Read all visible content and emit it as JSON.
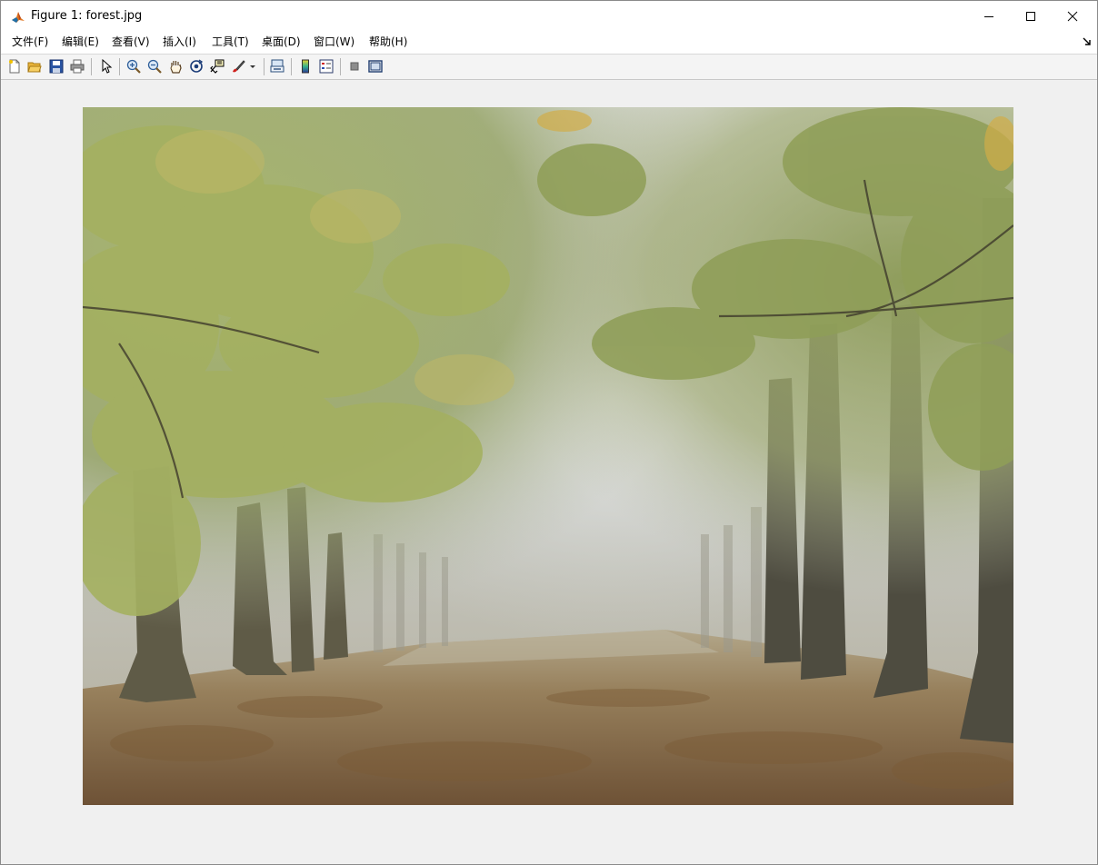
{
  "window": {
    "title": "Figure 1: forest.jpg",
    "icon": "matlab-logo-icon"
  },
  "window_controls": [
    "minimize-icon",
    "maximize-icon",
    "close-icon"
  ],
  "menu": [
    {
      "label": "文件(F)"
    },
    {
      "label": "编辑(E)"
    },
    {
      "label": "查看(V)"
    },
    {
      "label": "插入(I)"
    },
    {
      "label": "工具(T)"
    },
    {
      "label": "桌面(D)"
    },
    {
      "label": "窗口(W)"
    },
    {
      "label": "帮助(H)"
    }
  ],
  "toolbar": [
    "new-figure-icon",
    "open-file-icon",
    "save-icon",
    "print-icon",
    "edit-plot-arrow-icon",
    "zoom-in-icon",
    "zoom-out-icon",
    "pan-hand-icon",
    "rotate-3d-icon",
    "data-cursor-icon",
    "brush-icon",
    "brush-dropdown-icon",
    "link-plot-icon",
    "insert-colorbar-icon",
    "insert-legend-icon",
    "hide-plot-tools-icon",
    "show-plot-tools-icon"
  ],
  "figure": {
    "image_subject": "misty forest avenue in autumn",
    "colors": {
      "sky_fog": "#c8cbc7",
      "foliage": "#9aa663",
      "trunks": "#4d4b3e",
      "ground": "#8a6e48"
    }
  }
}
